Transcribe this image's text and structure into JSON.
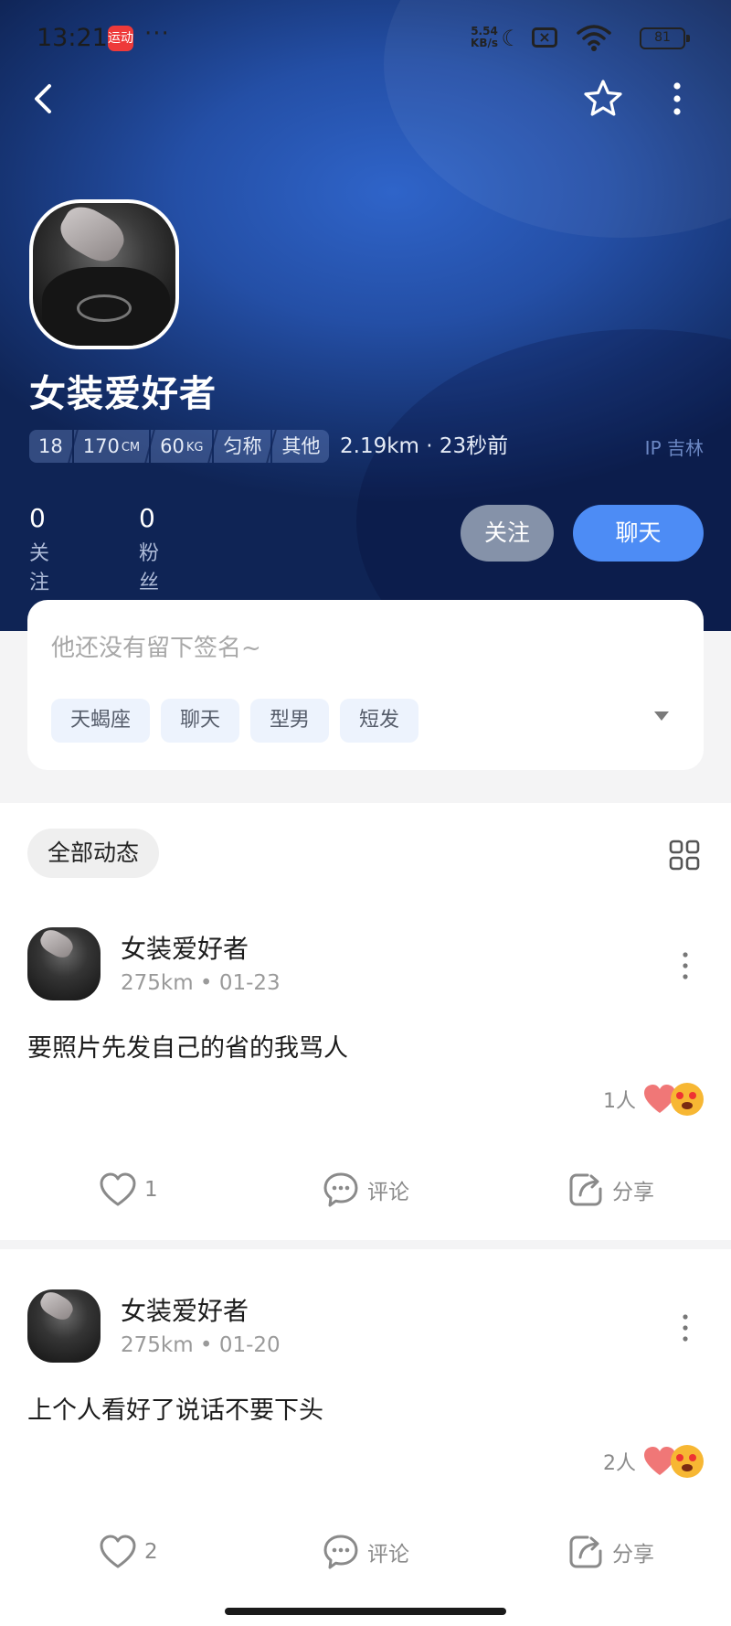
{
  "status_bar": {
    "time": "13:21",
    "app_badge": "运动",
    "dots": "···",
    "net_speed_value": "5.54",
    "net_speed_unit": "KB/s",
    "battery": "81"
  },
  "profile": {
    "nickname": "女装爱好者",
    "stats": [
      {
        "value": "18",
        "unit": ""
      },
      {
        "value": "170",
        "unit": "CM"
      },
      {
        "value": "60",
        "unit": "KG"
      },
      {
        "value": "匀称",
        "unit": ""
      },
      {
        "value": "其他",
        "unit": ""
      }
    ],
    "distance_time": "2.19km · 23秒前",
    "ip_location": "IP 吉林",
    "following_count": "0",
    "following_label": "关注",
    "followers_count": "0",
    "followers_label": "粉丝",
    "follow_button": "关注",
    "chat_button": "聊天"
  },
  "signature": {
    "text": "他还没有留下签名~",
    "chips": [
      "天蝎座",
      "聊天",
      "型男",
      "短发"
    ]
  },
  "feed": {
    "tab_label": "全部动态",
    "posts": [
      {
        "author": "女装爱好者",
        "meta": "275km • 01-23",
        "text": "要照片先发自己的省的我骂人",
        "reaction_count": "1人",
        "like_count": "1",
        "comment_label": "评论",
        "share_label": "分享"
      },
      {
        "author": "女装爱好者",
        "meta": "275km • 01-20",
        "text": "上个人看好了说话不要下头",
        "reaction_count": "2人",
        "like_count": "2",
        "comment_label": "评论",
        "share_label": "分享"
      }
    ]
  },
  "colors": {
    "accent_blue": "#4d8cf5",
    "follow_gray": "#8592a9",
    "header_blue": "#244fa6"
  }
}
